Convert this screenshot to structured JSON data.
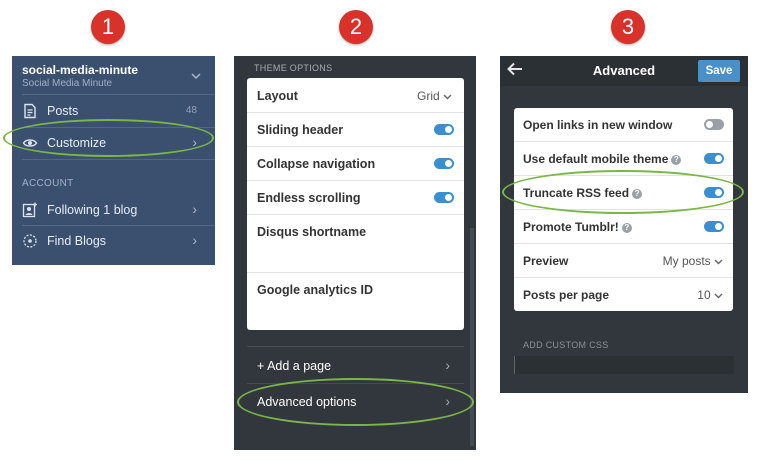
{
  "steps": [
    "1",
    "2",
    "3"
  ],
  "colors": {
    "accent_blue": "#3a8fd0",
    "panel_dark": "#32373d",
    "sidebar_blue": "#3b506f",
    "highlight_green": "#7ab648",
    "step_red": "#d9322b"
  },
  "panel1": {
    "account_name": "social-media-minute",
    "account_subtitle": "Social Media Minute",
    "items": [
      {
        "label": "Posts",
        "count": "48",
        "icon": "document-icon"
      },
      {
        "label": "Customize",
        "icon": "eye-icon"
      }
    ],
    "section_label": "ACCOUNT",
    "account_items": [
      {
        "label": "Following 1 blog",
        "icon": "follow-person-icon"
      },
      {
        "label": "Find Blogs",
        "icon": "compass-icon"
      }
    ]
  },
  "panel2": {
    "header": "THEME OPTIONS",
    "rows": [
      {
        "label": "Layout",
        "value": "Grid"
      },
      {
        "label": "Sliding header",
        "toggle": true
      },
      {
        "label": "Collapse navigation",
        "toggle": true
      },
      {
        "label": "Endless scrolling",
        "toggle": true
      },
      {
        "label": "Disqus shortname",
        "value": ""
      },
      {
        "label": "Google analytics ID",
        "value": ""
      }
    ],
    "add_page": "+ Add a page",
    "advanced": "Advanced options"
  },
  "panel3": {
    "title": "Advanced",
    "save_label": "Save",
    "rows": [
      {
        "label": "Open links in new window",
        "toggle": false
      },
      {
        "label": "Use default mobile theme",
        "toggle": true,
        "help": "?"
      },
      {
        "label": "Truncate RSS feed",
        "toggle": true,
        "help": "?"
      },
      {
        "label": "Promote Tumblr!",
        "toggle": true,
        "help": "?"
      },
      {
        "label": "Preview",
        "value": "My posts"
      },
      {
        "label": "Posts per page",
        "value": "10"
      }
    ],
    "css_label": "ADD CUSTOM CSS"
  }
}
